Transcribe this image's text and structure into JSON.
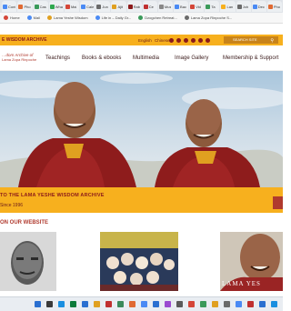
{
  "browser": {
    "tabs": [
      {
        "label": "Conf",
        "color": "#4a8af4"
      },
      {
        "label": "Pho",
        "color": "#e06a33"
      },
      {
        "label": "Cas",
        "color": "#3a9a5a"
      },
      {
        "label": "Wha",
        "color": "#2fa84f"
      },
      {
        "label": "Mai",
        "color": "#d44638"
      },
      {
        "label": "Cale",
        "color": "#4a8af4"
      },
      {
        "label": "Jun",
        "color": "#6a6a6a"
      },
      {
        "label": "Ajit",
        "color": "#e0a020"
      },
      {
        "label": "Rab",
        "color": "#8b1a1a"
      },
      {
        "label": "Ce",
        "color": "#c03030"
      },
      {
        "label": "Mus",
        "color": "#888"
      },
      {
        "label": "Bac",
        "color": "#4a8af4"
      },
      {
        "label": "Vid",
        "color": "#d44638"
      },
      {
        "label": "Ta",
        "color": "#3a9a5a"
      },
      {
        "label": "Lan",
        "color": "#f7b01e"
      },
      {
        "label": "Joh",
        "color": "#6a6a6a"
      },
      {
        "label": "Dec",
        "color": "#4a8af4"
      },
      {
        "label": "Pho",
        "color": "#e06a33"
      }
    ],
    "bookmarks": [
      {
        "label": "Home",
        "color": "#d44638"
      },
      {
        "label": "Mail",
        "color": "#4a8af4"
      },
      {
        "label": "Lama Yeshe Wisdom",
        "color": "#e0a020"
      },
      {
        "label": "Life in – Daily Gr...",
        "color": "#4a8af4"
      },
      {
        "label": "Dzogchen Retreat...",
        "color": "#3a9a5a"
      },
      {
        "label": "Lama Zopa Rinpoche S...",
        "color": "#6a6a6a"
      }
    ]
  },
  "site": {
    "title": "E WISDOM ARCHIVE",
    "lang_en": "English",
    "lang_other": "Chinese",
    "search_placeholder": "SEARCH SITE",
    "logo_line1": "…dom Archive of",
    "logo_line2": "Lama Zopa Rinpoche",
    "nav": [
      "Teachings",
      "Books & ebooks",
      "Multimedia",
      "Image Gallery",
      "Membership & Support"
    ],
    "banner_heading": "TO THE LAMA YESHE WISDOM ARCHIVE",
    "banner_sub": "Since 1996",
    "section_title": "ON OUR WEBSITE",
    "thumb_caption": "LAMA YES"
  },
  "colors": {
    "accent": "#f7b01e",
    "brand": "#b03a2e",
    "dark_red": "#8b1a1a"
  }
}
